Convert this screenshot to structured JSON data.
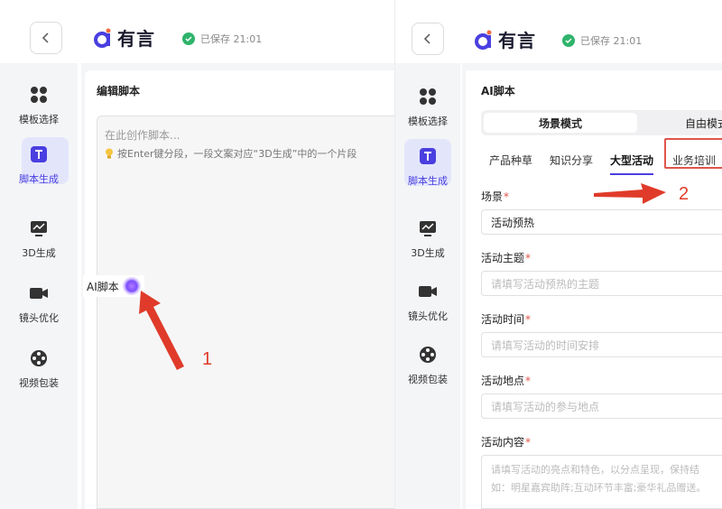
{
  "brand": {
    "name": "有言"
  },
  "status": {
    "saved_text": "已保存 21:01"
  },
  "sidebar": {
    "items": [
      {
        "label": "模板选择",
        "icon": "grid-icon"
      },
      {
        "label": "脚本生成",
        "icon": "text-t-icon"
      },
      {
        "label": "3D生成",
        "icon": "monitor-chart-icon"
      },
      {
        "label": "镜头优化",
        "icon": "video-camera-icon"
      },
      {
        "label": "视频包装",
        "icon": "film-reel-icon"
      }
    ],
    "active_index": 1
  },
  "sidebar_right": {
    "items": [
      {
        "label": "模板选择"
      },
      {
        "label": "脚本生成"
      },
      {
        "label": "3D生成"
      },
      {
        "label": "镜头优化"
      },
      {
        "label": "视频包装"
      }
    ]
  },
  "editor": {
    "title": "编辑脚本",
    "placeholder": "在此创作脚本...",
    "hint": "按Enter键分段，一段文案对应“3D生成”中的一个片段",
    "ai_button": "AI脚本"
  },
  "annotations": {
    "one": "1",
    "two": "2"
  },
  "ai_script": {
    "title": "AI脚本",
    "modes": [
      "场景模式",
      "自由模式"
    ],
    "selected_mode": "场景模式",
    "tabs": [
      "产品种草",
      "知识分享",
      "大型活动",
      "业务培训"
    ],
    "active_tab": "大型活动",
    "highlighted_tab": "业务培训",
    "fields": [
      {
        "label": "场景",
        "value": "活动预热",
        "required": true
      },
      {
        "label": "活动主题",
        "placeholder": "请填写活动预热的主题",
        "required": true
      },
      {
        "label": "活动时间",
        "placeholder": "请填写活动的时间安排",
        "required": true
      },
      {
        "label": "活动地点",
        "placeholder": "请填写活动的参与地点",
        "required": true
      },
      {
        "label": "活动内容",
        "placeholder_line1": "请填写活动的亮点和特色，以分点呈现，保持结",
        "placeholder_line2": "如：明星嘉宾助阵;互动环节丰富;豪华礼品赠送。",
        "required": true
      }
    ]
  }
}
